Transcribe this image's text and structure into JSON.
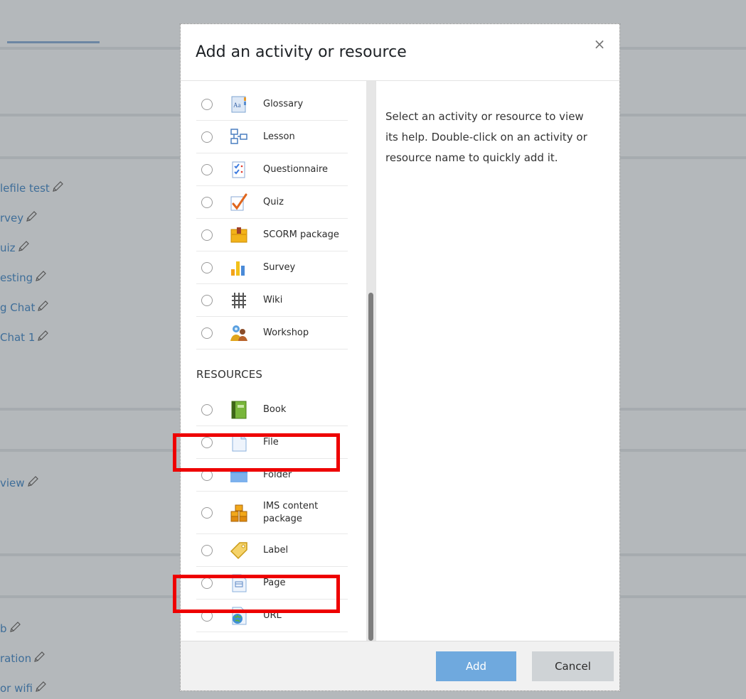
{
  "background": {
    "links": [
      {
        "text": "lefile test"
      },
      {
        "text": "rvey"
      },
      {
        "text": "uiz"
      },
      {
        "text": "esting"
      },
      {
        "text": "g Chat"
      },
      {
        "text": "Chat 1"
      },
      {
        "text": "view"
      },
      {
        "text": "b"
      },
      {
        "text": "ration"
      },
      {
        "text": "or wifi"
      }
    ]
  },
  "dialog": {
    "title": "Add an activity or resource",
    "close_icon": "×",
    "activities": [
      {
        "label": "Glossary",
        "icon": "glossary-icon"
      },
      {
        "label": "Lesson",
        "icon": "lesson-icon"
      },
      {
        "label": "Questionnaire",
        "icon": "questionnaire-icon"
      },
      {
        "label": "Quiz",
        "icon": "quiz-icon"
      },
      {
        "label": "SCORM package",
        "icon": "scorm-icon"
      },
      {
        "label": "Survey",
        "icon": "survey-icon"
      },
      {
        "label": "Wiki",
        "icon": "wiki-icon"
      },
      {
        "label": "Workshop",
        "icon": "workshop-icon"
      }
    ],
    "resources_heading": "RESOURCES",
    "resources": [
      {
        "label": "Book",
        "icon": "book-icon"
      },
      {
        "label": "File",
        "icon": "file-icon"
      },
      {
        "label": "Folder",
        "icon": "folder-icon"
      },
      {
        "label": "IMS content\npackage",
        "icon": "ims-package-icon"
      },
      {
        "label": "Label",
        "icon": "label-icon"
      },
      {
        "label": "Page",
        "icon": "page-icon"
      },
      {
        "label": "URL",
        "icon": "url-icon"
      }
    ],
    "help_text": "Select an activity or resource to view its help. Double-click on an activity or resource name to quickly add it.",
    "add_label": "Add",
    "cancel_label": "Cancel"
  },
  "colors": {
    "overlay": "#b4b8bb",
    "accent": "#6fa9de",
    "link": "#3f6e99",
    "highlight": "#ee0000"
  }
}
